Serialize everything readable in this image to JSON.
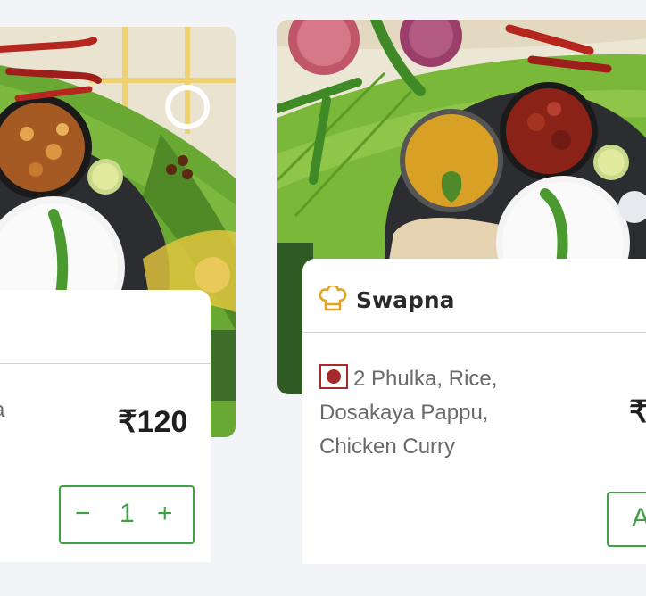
{
  "cards": [
    {
      "cook_name": "",
      "description_partial": "ya",
      "price": "₹120",
      "quantity": "1",
      "minus": "−",
      "plus": "+"
    },
    {
      "cook_name": "Swapna",
      "description_lines": [
        "2 Phulka, Rice,",
        "Dosakaya Pappu,",
        "Chicken Curry"
      ],
      "price_partial": "₹",
      "add_label": "A"
    }
  ],
  "colors": {
    "accent_green": "#3fa142",
    "nonveg_red": "#a52a2a",
    "chef_icon": "#e5a31f"
  },
  "icons": {
    "chef": "chef-hat-icon",
    "food_type": "non-veg-indicator-icon"
  }
}
